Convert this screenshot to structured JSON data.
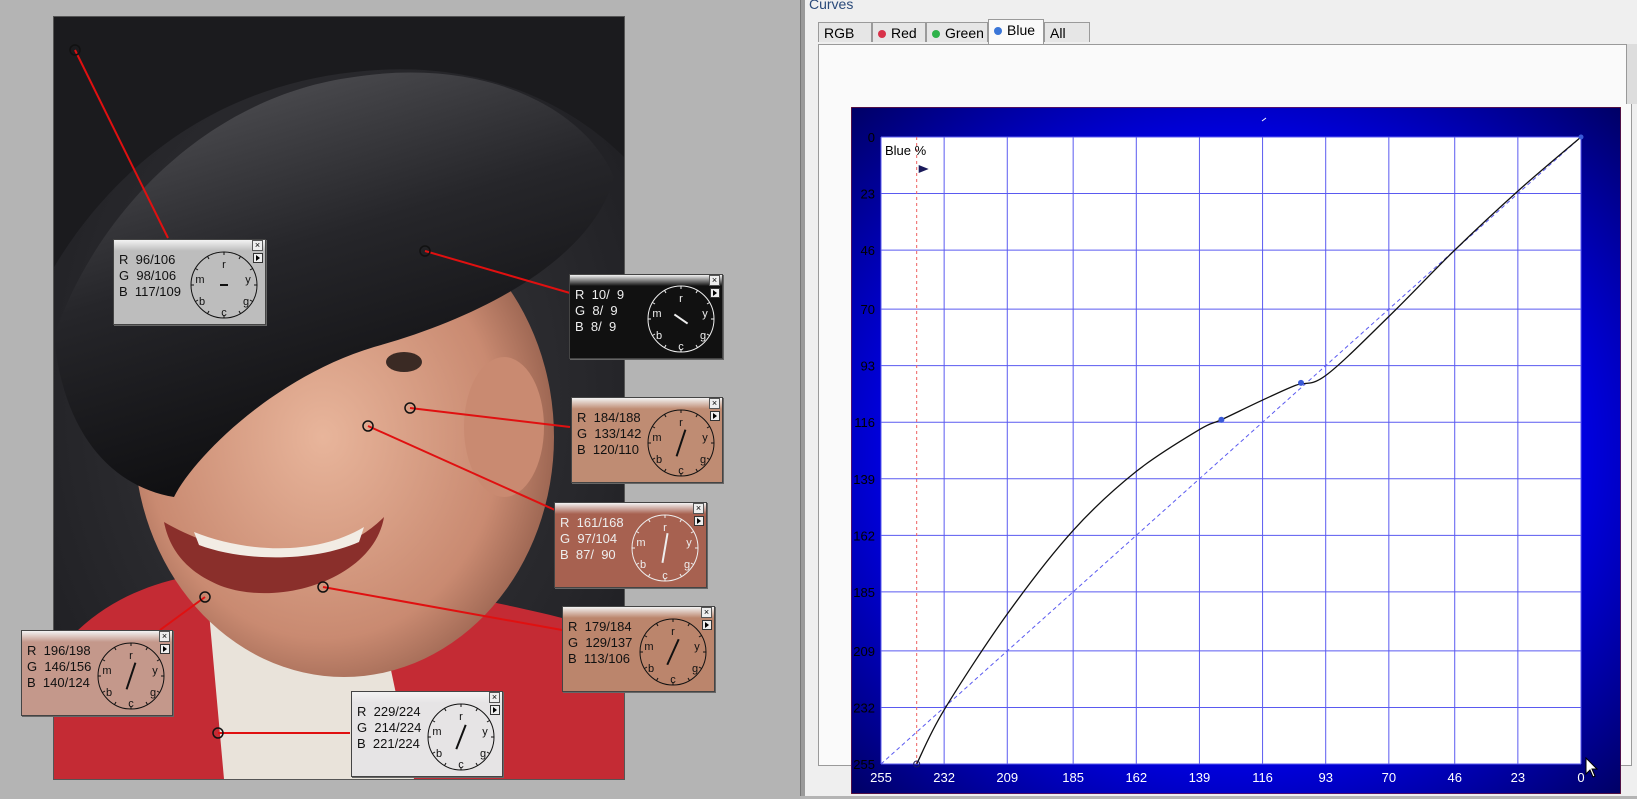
{
  "window": {
    "title": "Curves"
  },
  "tabs": [
    {
      "label": "RGB",
      "dot": null
    },
    {
      "label": "Red",
      "dot": "#d8324a"
    },
    {
      "label": "Green",
      "dot": "#2fb24a"
    },
    {
      "label": "Blue",
      "dot": "#3a76d8"
    },
    {
      "label": "All",
      "dot": null
    }
  ],
  "active_tab": "Blue",
  "samples": [
    {
      "R": "96/106",
      "G": "98/106",
      "B": "117/109",
      "bg": "#bdbdbd",
      "fg": "#111"
    },
    {
      "R": "10/  9",
      "G": "8/  9",
      "B": "8/  9",
      "bg": "#111111",
      "fg": "#eee"
    },
    {
      "R": "184/188",
      "G": "133/142",
      "B": "120/110",
      "bg": "#bf8c73",
      "fg": "#111"
    },
    {
      "R": "161/168",
      "G": "97/104",
      "B": "87/  90",
      "bg": "#a76150",
      "fg": "#eee"
    },
    {
      "R": "179/184",
      "G": "129/137",
      "B": "113/106",
      "bg": "#bb856c",
      "fg": "#111"
    },
    {
      "R": "196/198",
      "G": "146/156",
      "B": "140/124",
      "bg": "#c4988b",
      "fg": "#111"
    },
    {
      "R": "229/224",
      "G": "214/224",
      "B": "221/224",
      "bg": "#e6e4e5",
      "fg": "#111"
    }
  ],
  "dial_labels": {
    "top": "r",
    "right": "y",
    "bottom_right": "g",
    "bottom": "c",
    "bottom_left": "b",
    "left": "m"
  },
  "chart_data": {
    "type": "line",
    "title": "",
    "ylabel": "Blue %",
    "x_ticks": [
      255,
      232,
      209,
      185,
      162,
      139,
      116,
      93,
      70,
      46,
      23,
      0
    ],
    "y_ticks": [
      0,
      23,
      46,
      70,
      93,
      116,
      139,
      162,
      185,
      209,
      232,
      255
    ],
    "xlim": [
      255,
      0
    ],
    "ylim": [
      0,
      255
    ],
    "grid": true,
    "series": [
      {
        "values_xy": [
          [
            242,
            255
          ],
          [
            232,
            233
          ],
          [
            209,
            194
          ],
          [
            185,
            160
          ],
          [
            162,
            136
          ],
          [
            139,
            119
          ],
          [
            131,
            115
          ],
          [
            116,
            107
          ],
          [
            104,
            101
          ],
          [
            93,
            97
          ],
          [
            70,
            73
          ],
          [
            46,
            46
          ],
          [
            23,
            22
          ],
          [
            0,
            0
          ]
        ]
      },
      {
        "values_xy": [
          [
            255,
            255
          ],
          [
            0,
            0
          ]
        ]
      }
    ],
    "control_points": [
      [
        131,
        115
      ],
      [
        102,
        100
      ]
    ],
    "histogram": [
      0,
      0,
      0,
      0,
      0,
      0,
      0,
      0,
      0,
      0,
      0,
      0,
      0,
      0,
      0,
      0,
      0,
      0,
      0,
      0,
      0,
      0,
      0,
      0,
      0,
      0,
      0,
      0,
      0,
      0,
      0,
      0,
      0,
      0,
      0,
      0,
      0,
      0,
      0,
      0,
      0,
      0,
      0,
      0,
      0,
      0,
      0,
      0,
      0,
      0,
      0,
      0,
      0,
      0,
      0,
      0,
      0,
      0,
      0,
      0,
      0,
      0,
      0,
      0,
      0,
      0,
      0,
      0,
      0,
      0,
      0,
      0,
      0,
      0,
      0,
      0,
      0,
      0,
      0,
      0,
      0,
      0,
      0,
      0,
      0,
      0,
      0,
      0,
      0,
      0,
      0,
      0,
      0,
      0,
      0,
      0,
      0,
      0,
      0,
      0,
      0,
      0,
      0,
      0,
      0,
      0,
      0,
      0,
      0,
      0,
      0,
      0,
      0,
      0,
      0,
      0,
      0,
      0,
      0,
      0,
      0,
      0,
      0,
      0,
      0,
      0,
      0,
      0,
      0,
      0,
      0,
      0,
      0,
      0,
      0,
      0,
      0,
      0,
      0,
      0,
      0,
      0,
      0,
      0,
      0,
      0,
      0,
      0,
      0,
      0,
      0,
      0,
      0,
      0,
      0,
      0,
      0,
      0,
      0,
      0,
      0,
      0,
      0,
      0,
      0,
      0,
      0,
      0,
      0,
      0,
      0,
      0,
      0,
      0,
      0,
      0,
      0,
      0,
      0,
      0,
      0,
      0,
      0,
      0,
      0,
      0,
      0,
      0,
      0,
      0,
      0,
      0,
      0,
      0,
      0,
      0,
      0,
      0,
      0,
      0,
      0,
      0,
      0,
      0,
      0,
      0,
      0,
      0,
      0,
      0,
      0,
      0,
      0,
      0,
      0,
      0,
      0,
      0,
      0,
      0,
      0,
      0,
      0,
      0,
      0,
      0,
      0,
      0,
      0,
      0,
      0,
      0,
      0,
      0,
      0,
      0,
      0,
      0,
      0,
      0,
      0,
      0,
      0,
      0,
      0,
      0,
      0,
      0,
      0,
      0,
      0,
      0,
      0,
      0,
      0,
      0,
      0,
      0
    ],
    "pointer_x": 242
  },
  "colors": {
    "chart_bg_dark": "#000050",
    "grid": "#5a5af0",
    "curve": "#111111",
    "histogram": "#b9b9b9",
    "connector": "#e01010"
  }
}
